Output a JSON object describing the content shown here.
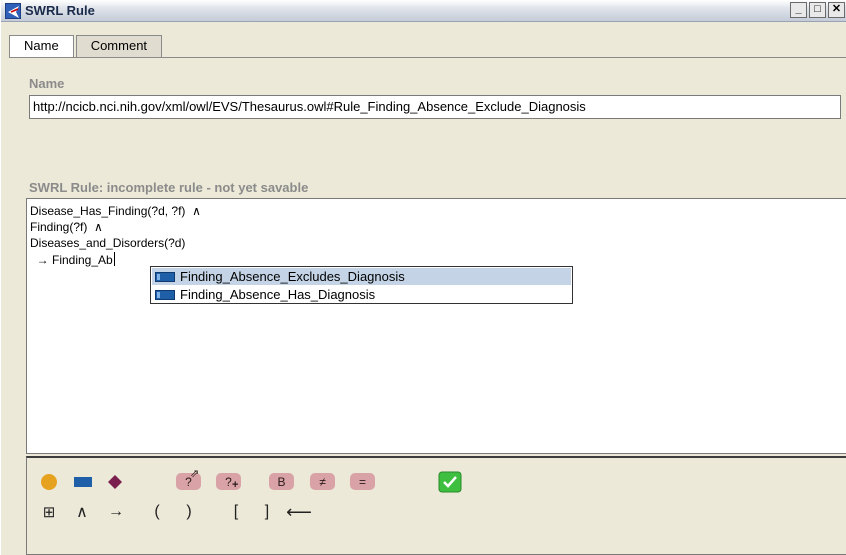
{
  "window": {
    "title": "SWRL Rule",
    "controls": {
      "minimize": "_",
      "maximize": "□",
      "close": "✕"
    }
  },
  "tabs": [
    {
      "label": "Name",
      "active": true
    },
    {
      "label": "Comment",
      "active": false
    }
  ],
  "name_section": {
    "label": "Name",
    "value": "http://ncicb.nci.nih.gov/xml/owl/EVS/Thesaurus.owl#Rule_Finding_Absence_Exclude_Diagnosis"
  },
  "rule_section": {
    "label": "SWRL Rule: incomplete rule - not yet savable",
    "lines": [
      "Disease_Has_Finding(?d, ?f)  ∧",
      "Finding(?f)  ∧",
      "Diseases_and_Disorders(?d)",
      "  → Finding_Ab"
    ]
  },
  "autocomplete": {
    "items": [
      {
        "label": "Finding_Absence_Excludes_Diagnosis",
        "selected": true,
        "icon": "object-property-icon"
      },
      {
        "label": "Finding_Absence_Has_Diagnosis",
        "selected": false,
        "icon": "object-property-icon"
      }
    ]
  },
  "toolbar": {
    "row1": {
      "class_icon": "orange-circle",
      "property_icon": "blue-rectangle",
      "individual_icon": "purple-diamond",
      "variable_label": "?",
      "new_variable_label": "?",
      "builtin_label": "B",
      "not_equal_label": "≠",
      "equal_label": "=",
      "validate_icon": "green-check"
    },
    "row2": {
      "grid_label": "⊞",
      "and_label": "∧",
      "implies_label": "→",
      "open_paren": "(",
      "close_paren": ")",
      "open_bracket": "[",
      "close_bracket": "]",
      "backspace_label": "⟵"
    }
  },
  "colors": {
    "class": "#e6a21e",
    "property": "#1f5fa8",
    "individual": "#7b1f4f",
    "pill": "#d8a2a6",
    "check": "#3fbf3f",
    "selection": "#c4d4e6"
  }
}
